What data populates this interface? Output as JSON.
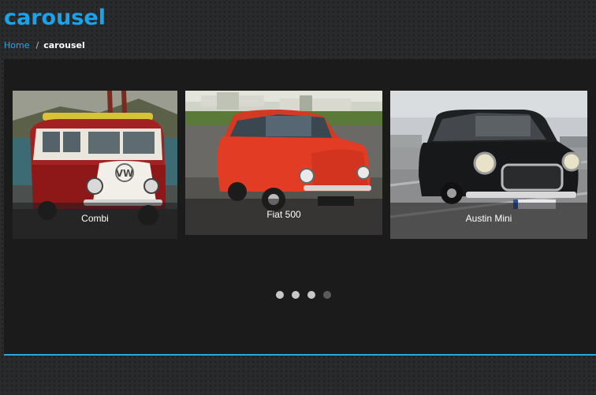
{
  "page": {
    "title": "carousel"
  },
  "breadcrumb": {
    "home_label": "Home",
    "separator": "/",
    "current_label": "carousel"
  },
  "carousel": {
    "slides": [
      {
        "caption": "Combi"
      },
      {
        "caption": "Fiat 500"
      },
      {
        "caption": "Austin Mini"
      }
    ],
    "pagination": {
      "page_count": 4,
      "active_index": 3
    }
  },
  "colors": {
    "accent": "#1aa3e8",
    "panel_background": "#1b1b1b",
    "page_background": "#2a2b2d"
  }
}
